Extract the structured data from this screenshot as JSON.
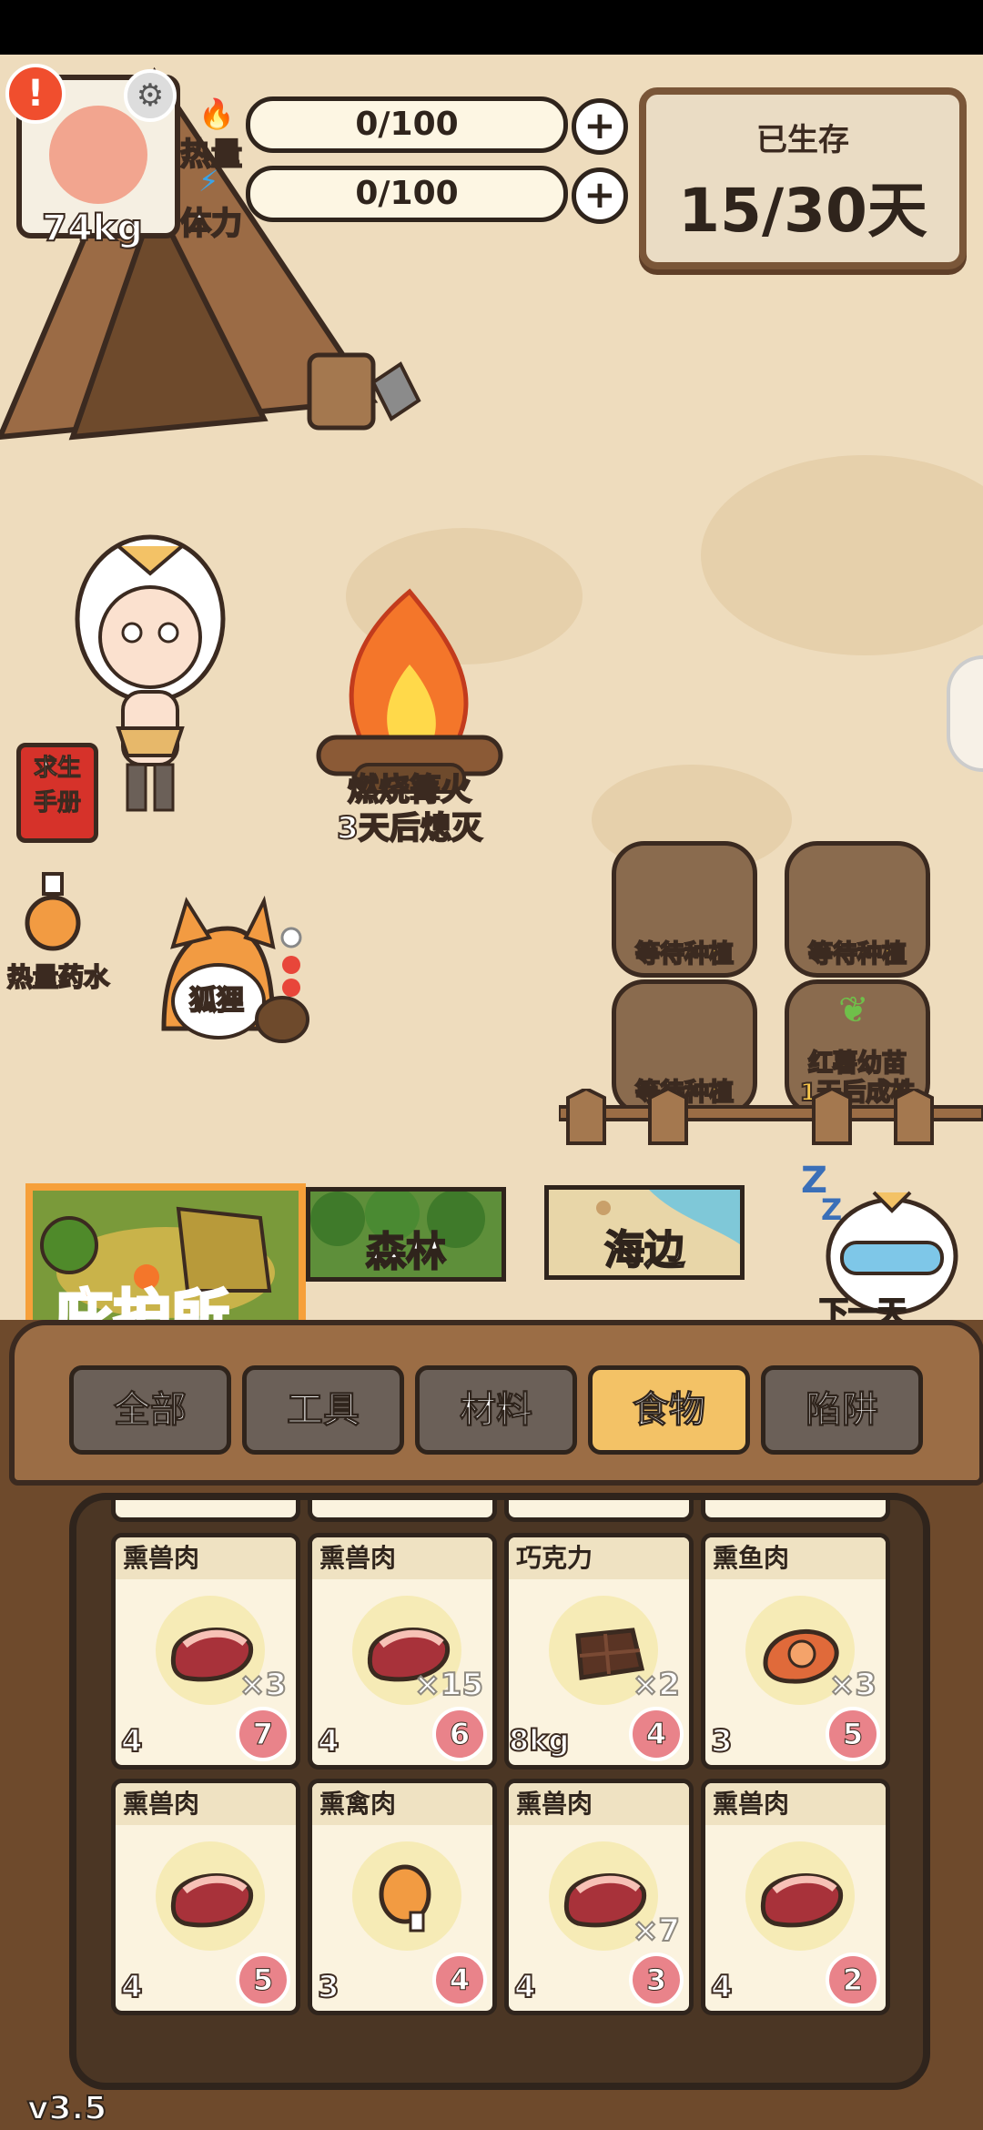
{
  "player": {
    "weight": "74kg"
  },
  "stats": [
    {
      "label": "热量",
      "value": "0/100",
      "icon": "flame-icon"
    },
    {
      "label": "体力",
      "value": "0/100",
      "icon": "lightning-icon"
    }
  ],
  "survival": {
    "label": "已生存",
    "days": "15/30天"
  },
  "campfire": {
    "title": "燃烧篝火",
    "status": "3天后熄灭"
  },
  "side": {
    "manual": [
      "求生",
      "手册"
    ],
    "potion_label": "热量药水"
  },
  "pet": {
    "name": "狐狸"
  },
  "plots": [
    {
      "label": "等待种植"
    },
    {
      "label": "等待种植"
    },
    {
      "label": "等待种植"
    },
    {
      "label": "红薯幼苗\n1天后成株"
    }
  ],
  "locations": [
    {
      "label": "庇护所"
    },
    {
      "label": "森林"
    },
    {
      "label": "海边"
    }
  ],
  "next_day": "下一天",
  "tabs": [
    "全部",
    "工具",
    "材料",
    "食物",
    "陷阱"
  ],
  "active_tab": 3,
  "inventory": [
    {
      "name": "熏兽肉",
      "qty": "×3",
      "heat": "4",
      "hunger": "7",
      "icon": "meat-icon"
    },
    {
      "name": "熏兽肉",
      "qty": "×15",
      "heat": "4",
      "hunger": "6",
      "icon": "meat-icon"
    },
    {
      "name": "巧克力",
      "qty": "×2",
      "weight": "8kg",
      "hunger": "4",
      "icon": "chocolate-icon"
    },
    {
      "name": "熏鱼肉",
      "qty": "×3",
      "heat": "3",
      "hunger": "5",
      "icon": "fish-icon"
    },
    {
      "name": "熏兽肉",
      "qty": "",
      "heat": "4",
      "hunger": "5",
      "icon": "meat-icon"
    },
    {
      "name": "熏禽肉",
      "qty": "",
      "heat": "3",
      "hunger": "4",
      "icon": "drumstick-icon"
    },
    {
      "name": "熏兽肉",
      "qty": "×7",
      "heat": "4",
      "hunger": "3",
      "icon": "meat-icon"
    },
    {
      "name": "熏兽肉",
      "qty": "",
      "heat": "4",
      "hunger": "2",
      "icon": "meat-icon"
    }
  ],
  "version": "v3.5",
  "colors": {
    "accent": "#f3c266",
    "shelter": "#f6a03a",
    "bag": "#6e4a2c",
    "ground": "#eedcbd"
  }
}
